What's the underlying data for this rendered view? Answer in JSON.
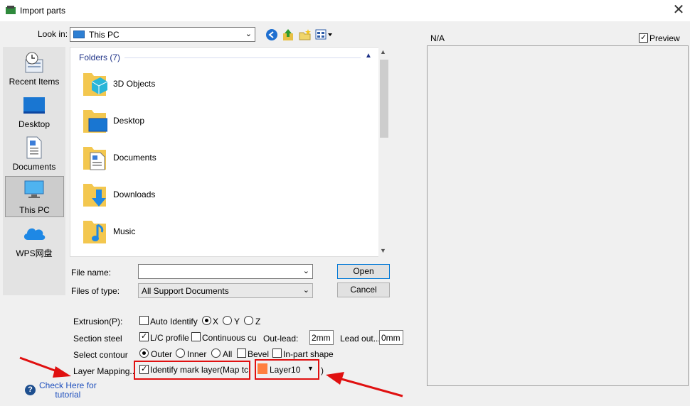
{
  "window": {
    "title": "Import parts",
    "close_glyph": "✕"
  },
  "look_in": {
    "label": "Look in:",
    "value": "This PC"
  },
  "places": [
    {
      "label": "Recent Items",
      "icon": "recent-items-icon"
    },
    {
      "label": "Desktop",
      "icon": "desktop-icon"
    },
    {
      "label": "Documents",
      "icon": "documents-icon"
    },
    {
      "label": "This PC",
      "icon": "this-pc-icon",
      "selected": true
    },
    {
      "label": "WPS网盘",
      "icon": "cloud-icon"
    }
  ],
  "file_list": {
    "group_header": "Folders (7)",
    "folders": [
      {
        "label": "3D Objects",
        "icon": "3d-objects-folder-icon"
      },
      {
        "label": "Desktop",
        "icon": "desktop-folder-icon"
      },
      {
        "label": "Documents",
        "icon": "documents-folder-icon"
      },
      {
        "label": "Downloads",
        "icon": "downloads-folder-icon"
      },
      {
        "label": "Music",
        "icon": "music-folder-icon"
      }
    ]
  },
  "file_name": {
    "label": "File name:",
    "value": ""
  },
  "file_type": {
    "label": "Files of type:",
    "value": "All Support Documents"
  },
  "buttons": {
    "open": "Open",
    "cancel": "Cancel"
  },
  "options": {
    "extrusion": {
      "label": "Extrusion(P):",
      "auto_identify": "Auto Identify",
      "x": "X",
      "y": "Y",
      "z": "Z",
      "selected_axis": "X",
      "auto_checked": false
    },
    "section_steel": {
      "label": "Section steel",
      "lc_profile": "L/C profile",
      "lc_checked": true,
      "continuous": "Continuous cu",
      "continuous_checked": false,
      "out_lead_label": "Out-lead:",
      "out_lead_value": "2mm",
      "lead_out_label": "Lead out...",
      "lead_out_value": "0mm"
    },
    "select_contour": {
      "label": "Select contour",
      "outer": "Outer",
      "inner": "Inner",
      "all": "All",
      "selected": "Outer",
      "bevel": "Bevel",
      "bevel_checked": false,
      "in_part_shape": "In-part shape",
      "in_part_checked": false
    },
    "layer_mapping": {
      "label": "Layer Mapping..",
      "identify": "Identify mark layer(Map tc",
      "identify_checked": true,
      "layer_value": "Layer10",
      "layer_color": "#ff7f3f",
      "closing_paren": ")"
    }
  },
  "help": {
    "line1": "Check Here for",
    "line2": "tutorial"
  },
  "preview": {
    "na_text": "N/A",
    "label": "Preview",
    "checked": true
  },
  "annotation_color": "#e01010"
}
